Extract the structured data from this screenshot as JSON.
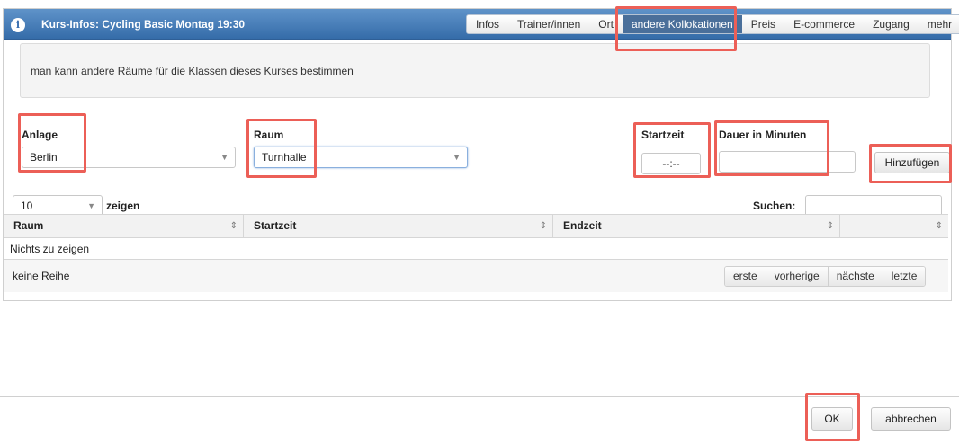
{
  "dialog": {
    "title": "Kurs-Infos: Cycling Basic Montag 19:30",
    "info_icon": "i"
  },
  "tabs": [
    {
      "label": "Infos"
    },
    {
      "label": "Trainer/innen"
    },
    {
      "label": "Ort"
    },
    {
      "label": "andere Kollokationen",
      "active": true
    },
    {
      "label": "Preis"
    },
    {
      "label": "E-commerce"
    },
    {
      "label": "Zugang"
    },
    {
      "label": "mehr"
    }
  ],
  "note": "man kann andere Räume für die Klassen dieses Kurses bestimmen",
  "form": {
    "anlage_label": "Anlage",
    "anlage_value": "Berlin",
    "raum_label": "Raum",
    "raum_value": "Turnhalle",
    "startzeit_label": "Startzeit",
    "startzeit_value": "--:--",
    "dauer_label": "Dauer in Minuten",
    "dauer_value": "",
    "add_button": "Hinzufügen"
  },
  "table": {
    "page_size": "10",
    "page_size_suffix": "zeigen",
    "search_label": "Suchen:",
    "search_value": "",
    "columns": [
      "Raum",
      "Startzeit",
      "Endzeit",
      ""
    ],
    "empty_text": "Nichts zu zeigen",
    "info_text": "keine Reihe",
    "pager": [
      "erste",
      "vorherige",
      "nächste",
      "letzte"
    ]
  },
  "buttons": {
    "ok": "OK",
    "cancel": "abbrechen"
  },
  "colors": {
    "titlebar": "#356ca9",
    "highlight": "#ec5f57",
    "active_tab": "#4a6f9a"
  }
}
